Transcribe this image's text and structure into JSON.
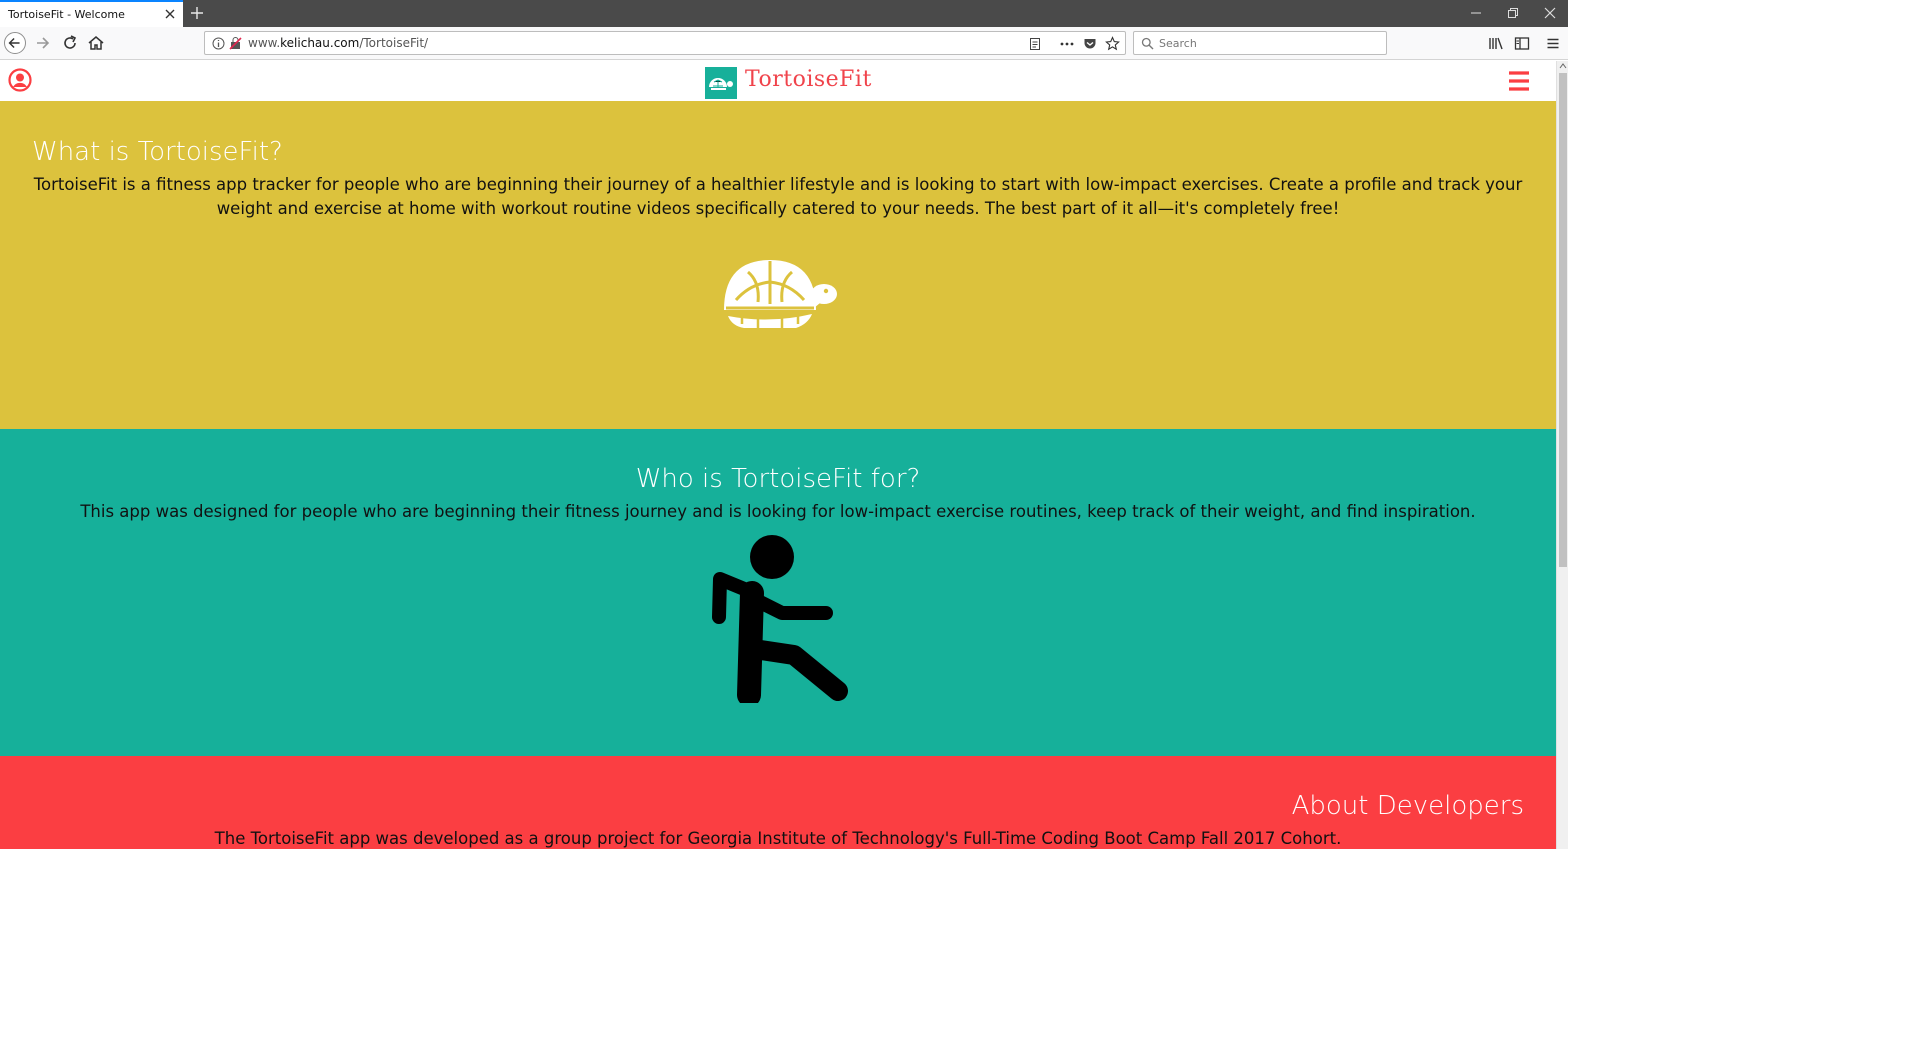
{
  "browser": {
    "tab_title": "TortoiseFit - Welcome",
    "url_prefix": "www.",
    "url_domain": "kelichau.com",
    "url_path": "/TortoiseFit/",
    "search_placeholder": "Search"
  },
  "site": {
    "logo_text": "TortoiseFit",
    "brand_red": "#fb3e42",
    "brand_teal": "#16b09a",
    "brand_yellow": "#dcc23d"
  },
  "sections": {
    "what": {
      "heading": "What is TortoiseFit?",
      "body": "TortoiseFit is a fitness app tracker for people who are beginning their journey of a healthier lifestyle and is looking to start with low-impact exercises. Create a profile and track your weight and exercise at home with workout routine videos specifically catered to your needs. The best part of it all—it's completely free!",
      "icon": "tortoise-icon"
    },
    "who": {
      "heading": "Who is TortoiseFit for?",
      "body": "This app was designed for people who are beginning their fitness journey and is looking for low-impact exercise routines, keep track of their weight, and find inspiration.",
      "icon": "walking-person-icon"
    },
    "about": {
      "heading": "About Developers",
      "body": "The TortoiseFit app was developed as a group project for Georgia Institute of Technology's Full-Time Coding Boot Camp Fall 2017 Cohort."
    }
  }
}
